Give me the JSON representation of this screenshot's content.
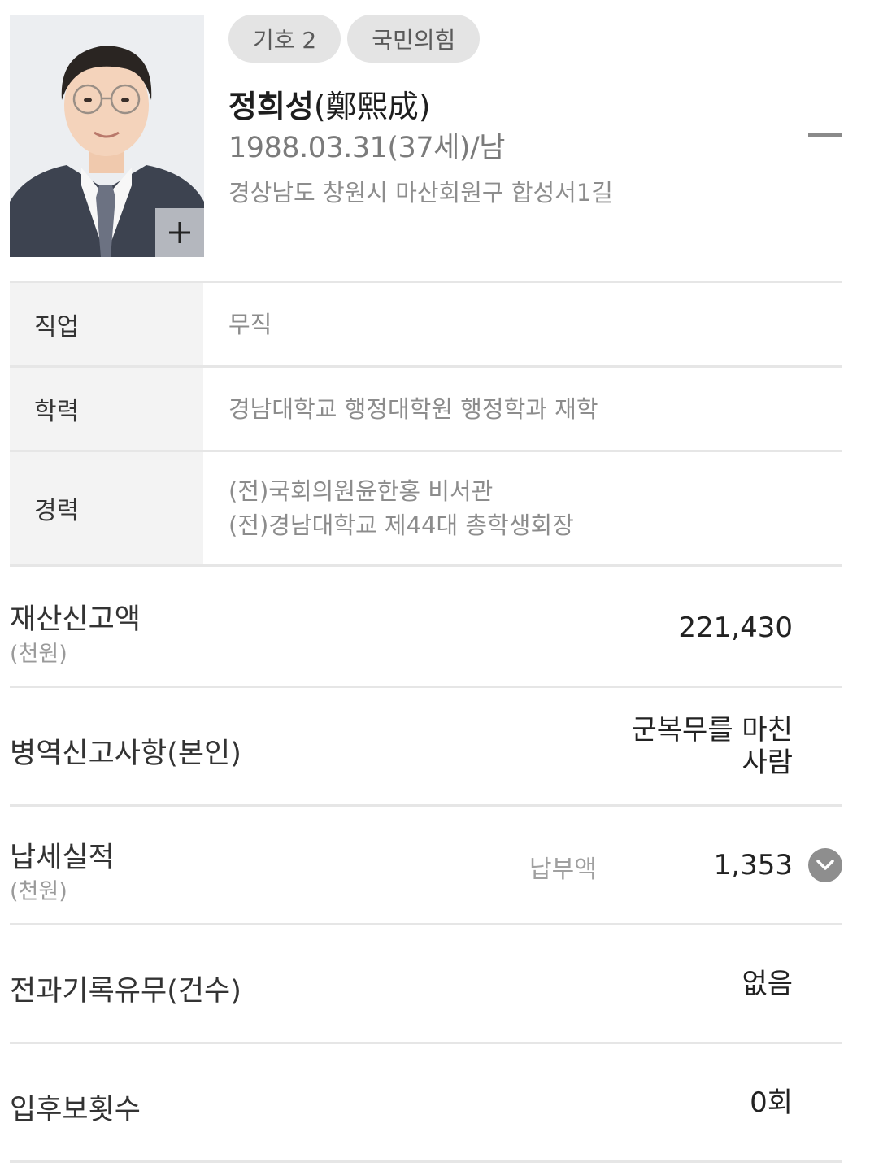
{
  "candidate": {
    "badges": [
      "기호 2",
      "국민의힘"
    ],
    "name": "정희성",
    "name_hanja": "(鄭熙成)",
    "birth_info": "1988.03.31(37세)/남",
    "address": "경상남도 창원시 마산회원구 합성서1길",
    "photo_plus_icon": "plus-icon",
    "collapse_icon": "minus-icon"
  },
  "info_table": [
    {
      "label": "직업",
      "values": [
        "무직"
      ]
    },
    {
      "label": "학력",
      "values": [
        "경남대학교 행정대학원 행정학과 재학"
      ]
    },
    {
      "label": "경력",
      "values": [
        "(전)국회의원윤한홍 비서관",
        "(전)경남대학교 제44대 총학생회장"
      ]
    }
  ],
  "property": {
    "label": "재산신고액",
    "unit": "(천원)",
    "value": "221,430"
  },
  "military": {
    "label": "병역신고사항(본인)",
    "value_line1": "군복무를 마친",
    "value_line2": "사람"
  },
  "tax": {
    "label": "납세실적",
    "unit": "(천원)",
    "mid_label": "납부액",
    "value": "1,353",
    "expand_icon": "chevron-down-icon"
  },
  "criminal": {
    "label": "전과기록유무(건수)",
    "value": "없음"
  },
  "candidacy": {
    "label": "입후보횟수",
    "value": "0회"
  }
}
